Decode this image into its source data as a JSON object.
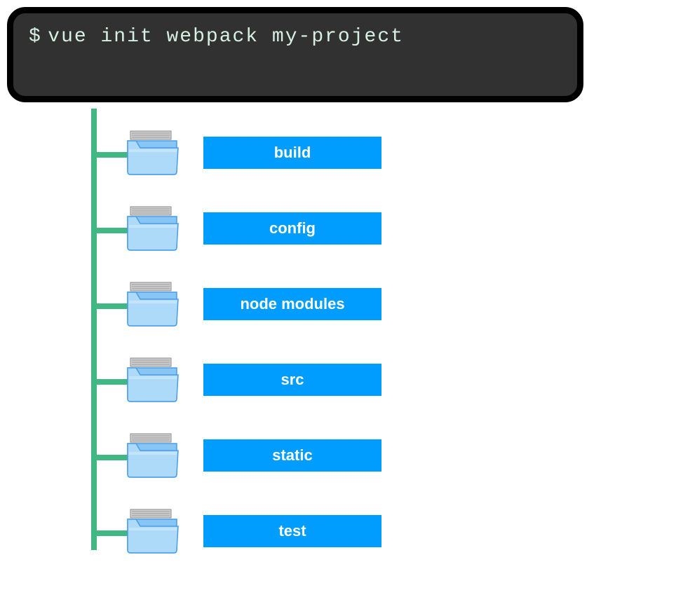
{
  "terminal": {
    "prompt": "$",
    "command": "vue init webpack my-project"
  },
  "folders": [
    {
      "label": "build"
    },
    {
      "label": "config"
    },
    {
      "label": "node modules"
    },
    {
      "label": "src"
    },
    {
      "label": "static"
    },
    {
      "label": "test"
    }
  ],
  "colors": {
    "terminal_bg": "#313131",
    "terminal_text": "#d6f1e2",
    "tree_line": "#41b883",
    "label_bg": "#009dff",
    "label_text": "#ffffff"
  }
}
